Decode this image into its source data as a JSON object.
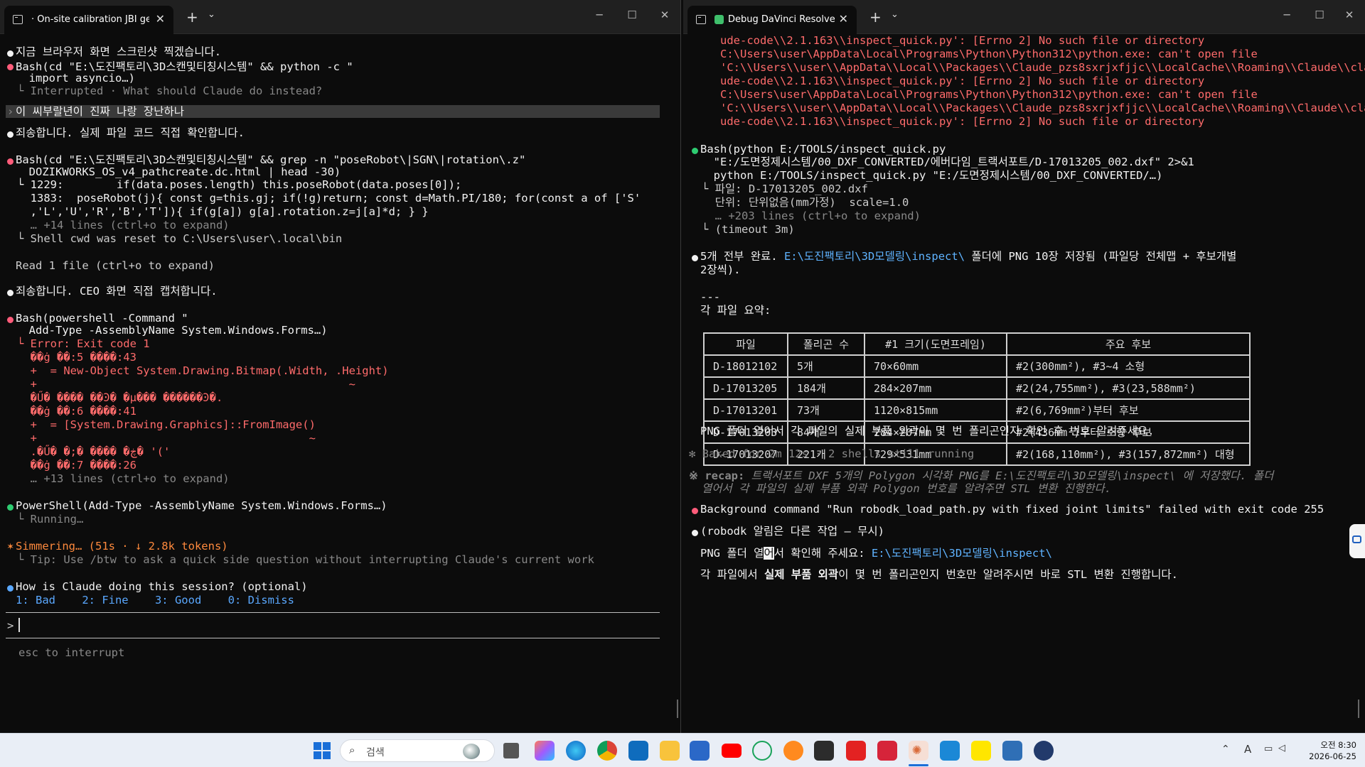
{
  "left_window": {
    "tab_title": "On-site calibration JBI gene",
    "tab_mark": "·",
    "lines": [
      {
        "text": "지금 브라우저 화면 스크린샷 찍겠습니다.",
        "cls": "w"
      },
      {
        "text": "Bash(cd \"E:\\도진팩토리\\3D스캔및티칭시스템\" && python -c \"",
        "cls": "w"
      },
      {
        "text": "  import asyncio…)",
        "cls": "w"
      },
      {
        "text": "└ Interrupted · What should Claude do instead?",
        "cls": "g"
      },
      {
        "text": "이 씨부랄년이 진짜 나랑 장난하나",
        "cls": "w"
      },
      {
        "text": "죄송합니다. 실제 파일 코드 직접 확인합니다.",
        "cls": "w"
      },
      {
        "text": "Bash(cd \"E:\\도진팩토리\\3D스캔및티칭시스템\" && grep -n \"poseRobot\\|SGN\\|rotation\\.z\"",
        "cls": "w"
      },
      {
        "text": "  DOZIKWORKS_OS_v4_pathcreate.dc.html | head -30)",
        "cls": "w"
      },
      {
        "text": "└ 1229:        if(data.poses.length) this.poseRobot(data.poses[0]);",
        "cls": "w"
      },
      {
        "text": "  1383:  poseRobot(j){ const g=this.gj; if(!g)return; const d=Math.PI/180; for(const a of ['S'",
        "cls": "w"
      },
      {
        "text": "  ,'L','U','R','B','T']){ if(g[a]) g[a].rotation.z=j[a]*d; } }",
        "cls": "w"
      },
      {
        "text": "  … +14 lines (ctrl+o to expand)",
        "cls": "g"
      },
      {
        "text": "└ Shell cwd was reset to C:\\Users\\user\\.local\\bin",
        "cls": ""
      },
      {
        "text": "Read 1 file (ctrl+o to expand)",
        "cls": ""
      },
      {
        "text": "죄송합니다. CEO 화면 직접 캡처합니다.",
        "cls": "w"
      },
      {
        "text": "Bash(powershell -Command \"",
        "cls": "w"
      },
      {
        "text": "  Add-Type -AssemblyName System.Windows.Forms…)",
        "cls": "w"
      },
      {
        "text": "└ Error: Exit code 1",
        "cls": "r"
      },
      {
        "text": "  ��ġ ��:5 ����:43",
        "cls": "r"
      },
      {
        "text": "  +  = New-Object System.Drawing.Bitmap(.Width, .Height)",
        "cls": "r"
      },
      {
        "text": "  +                                               ~",
        "cls": "r"
      },
      {
        "text": "  �Ű� ���� ��Ͽ� �µ��� ������Ͽ�.",
        "cls": "r"
      },
      {
        "text": "  ��ġ ��:6 ����:41",
        "cls": "r"
      },
      {
        "text": "  +  = [System.Drawing.Graphics]::FromImage()",
        "cls": "r"
      },
      {
        "text": "  +                                         ~",
        "cls": "r"
      },
      {
        "text": "  .�Ű� �;� ���� �ڿ� '('",
        "cls": "r"
      },
      {
        "text": "  ��ġ ��:7 ����:26",
        "cls": "r"
      },
      {
        "text": "  … +13 lines (ctrl+o to expand)",
        "cls": "g"
      },
      {
        "text": "PowerShell(Add-Type -AssemblyName System.Windows.Forms…)",
        "cls": "w"
      },
      {
        "text": "└ Running…",
        "cls": "g"
      },
      {
        "text": "Simmering… (51s · ↓ 2.8k tokens)",
        "cls": "or"
      },
      {
        "text": "└ Tip: Use /btw to ask a quick side question without interrupting Claude's current work",
        "cls": "g"
      },
      {
        "text": "How is Claude doing this session? (optional)",
        "cls": "w"
      },
      {
        "text": "1: Bad    2: Fine    3: Good    0: Dismiss",
        "cls": ""
      },
      {
        "text": "esc to interrupt",
        "cls": "g"
      }
    ],
    "prompt": ">",
    "bullet_star": "✶"
  },
  "right_window": {
    "tab_title": "Debug DaVinci Resolve pl",
    "error_lines": [
      "ude-code\\\\2.1.163\\\\inspect_quick.py': [Errno 2] No such file or directory",
      "C:\\Users\\user\\AppData\\Local\\Programs\\Python\\Python312\\python.exe: can't open file",
      "'C:\\\\Users\\\\user\\\\AppData\\\\Local\\\\Packages\\\\Claude_pzs8sxrjxfjjc\\\\LocalCache\\\\Roaming\\\\Claude\\\\cla",
      "ude-code\\\\2.1.163\\\\inspect_quick.py': [Errno 2] No such file or directory",
      "C:\\Users\\user\\AppData\\Local\\Programs\\Python\\Python312\\python.exe: can't open file",
      "'C:\\\\Users\\\\user\\\\AppData\\\\Local\\\\Packages\\\\Claude_pzs8sxrjxfjjc\\\\LocalCache\\\\Roaming\\\\Claude\\\\cla",
      "ude-code\\\\2.1.163\\\\inspect_quick.py': [Errno 2] No such file or directory"
    ],
    "lines": [
      {
        "text": "Bash(python E:/TOOLS/inspect_quick.py",
        "cls": "w"
      },
      {
        "text": "  \"E:/도면정제시스템/00_DXF_CONVERTED/에버다임_트랙서포트/D-17013205_002.dxf\" 2>&1",
        "cls": "w"
      },
      {
        "text": "  python E:/TOOLS/inspect_quick.py \"E:/도면정제시스템/00_DXF_CONVERTED/…)",
        "cls": "w"
      },
      {
        "text": "└ 파일: D-17013205_002.dxf",
        "cls": ""
      },
      {
        "text": "  단위: 단위없음(mm가정)  scale=1.0",
        "cls": ""
      },
      {
        "text": "  … +203 lines (ctrl+o to expand)",
        "cls": "g"
      },
      {
        "text": "└ (timeout 3m)",
        "cls": ""
      },
      {
        "text": "5개 전부 완료. ",
        "cls": "w"
      },
      {
        "text": "E:\\도진팩토리\\3D모델링\\inspect\\",
        "cls": "lnk"
      },
      {
        "text": " 폴더에 PNG 10장 저장됨 (파일당 전체맵 + 후보개별",
        "cls": "w"
      },
      {
        "text": "2장씩).",
        "cls": "w"
      },
      {
        "text": "---",
        "cls": "w"
      },
      {
        "text": "각 파일 요약:",
        "cls": "w"
      },
      {
        "text": "PNG 폴더 열어서 각 파일의 실제 부품 외곽이 몇 번 폴리곤인지 확인 후 번호 알려주세요.",
        "cls": "w"
      },
      {
        "text": "✻ Baked for 2m 12s · 2 shells still running",
        "cls": "g"
      },
      {
        "text": "※ recap: ",
        "cls": "g"
      },
      {
        "text": "트랙서포트 DXF 5개의 Polygon 시각화 PNG를 E:\\도진팩토리\\3D모델링\\inspect\\ 에 저장했다. 폴더",
        "cls": "g"
      },
      {
        "text": "열어서 각 파일의 실제 부품 외곽 Polygon 번호를 알려주면 STL 변환 진행한다.",
        "cls": "g"
      },
      {
        "text": "Background command \"Run robodk_load_path.py with fixed joint limits\" failed with exit code 255",
        "cls": "w"
      },
      {
        "text": "(robodk 알림은 다른 작업 — 무시)",
        "cls": "w"
      },
      {
        "text": "PNG 폴더 열",
        "cls": "w"
      },
      {
        "text": "어",
        "cls": "w"
      },
      {
        "text": "서 확인해 주세요: ",
        "cls": "w"
      },
      {
        "text": "E:\\도진팩토리\\3D모델링\\inspect\\",
        "cls": "lnk"
      },
      {
        "text": "각 파일에서 ",
        "cls": "w"
      },
      {
        "text": "실제 부품 외곽",
        "cls": "w"
      },
      {
        "text": "이 몇 번 폴리곤인지 번호만 알려주시면 바로 STL 변환 진행합니다.",
        "cls": "w"
      }
    ],
    "table": {
      "headers": [
        "파일",
        "폴리곤 수",
        "#1 크기(도면프레임)",
        "주요 후보"
      ],
      "rows": [
        [
          "D-18012102",
          "5개",
          "70×60mm",
          "#2(300mm²), #3~4 소형"
        ],
        [
          "D-17013205",
          "184개",
          "284×207mm",
          "#2(24,755mm²), #3(23,588mm²)"
        ],
        [
          "D-17013201",
          "73개",
          "1120×815mm",
          "#2(6,769mm²)부터 후보"
        ],
        [
          "D-17013203",
          "84개",
          "284×207mm",
          "#2(436mm²)부터 소형 후보"
        ],
        [
          "D-17013207",
          "221개",
          "729×531mm",
          "#2(168,110mm²), #3(157,872mm²) 대형"
        ]
      ]
    }
  },
  "taskbar": {
    "search_placeholder": "검색",
    "clock_time": "오전 8:30",
    "clock_date": "2026-06-25",
    "tray_lang": "A",
    "icons": [
      "windows-start-icon",
      "task-view-icon",
      "copilot-icon",
      "edge-icon",
      "chrome-icon",
      "outlook-icon",
      "file-explorer-icon",
      "store-icon",
      "youtube-icon",
      "app-green-icon",
      "search-app-icon",
      "terminal-icon",
      "acrobat-icon",
      "pdf-red-icon",
      "claude-icon",
      "vscode-icon",
      "kakaotalk-icon",
      "app-blue-icon",
      "app-navy-icon"
    ]
  },
  "colors": {
    "red_error": "#ff6b6b",
    "green_dot": "#2ecc71",
    "pink_dot": "#ff5c7a",
    "blue_dot": "#5aa8ff",
    "orange_status": "#ff8a3d",
    "link_blue": "#5fb3ff"
  }
}
